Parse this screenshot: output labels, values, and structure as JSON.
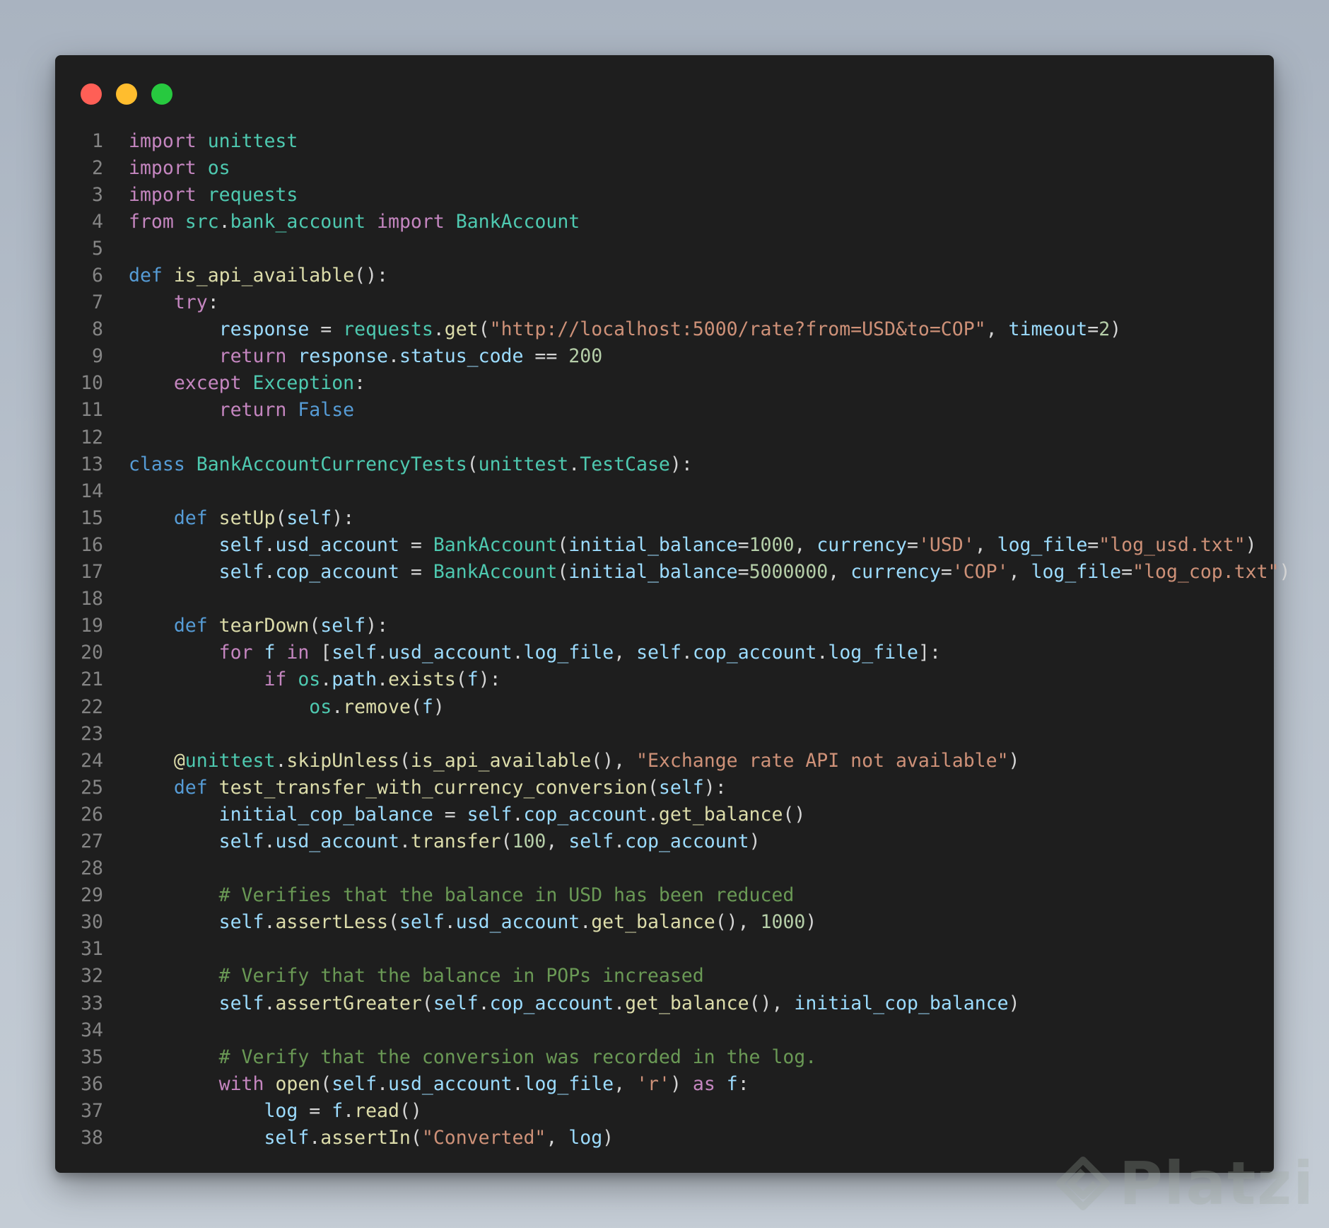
{
  "window": {
    "buttons": [
      {
        "name": "close",
        "color": "#ff5f56"
      },
      {
        "name": "minimize",
        "color": "#ffbd2e"
      },
      {
        "name": "maximize",
        "color": "#27c93f"
      }
    ]
  },
  "colors": {
    "keyword": "#c586c0",
    "definition": "#569cd6",
    "type": "#4ec9b0",
    "function": "#dcdcaa",
    "variable": "#9cdcfe",
    "string": "#ce9178",
    "number": "#b5cea8",
    "comment": "#6a9955",
    "plain": "#d4d4d4"
  },
  "code": {
    "language": "python",
    "lines": [
      [
        [
          "kw",
          "import"
        ],
        [
          "p",
          " "
        ],
        [
          "mod",
          "unittest"
        ]
      ],
      [
        [
          "kw",
          "import"
        ],
        [
          "p",
          " "
        ],
        [
          "mod",
          "os"
        ]
      ],
      [
        [
          "kw",
          "import"
        ],
        [
          "p",
          " "
        ],
        [
          "mod",
          "requests"
        ]
      ],
      [
        [
          "kw",
          "from"
        ],
        [
          "p",
          " "
        ],
        [
          "mod",
          "src"
        ],
        [
          "p",
          "."
        ],
        [
          "mod",
          "bank_account"
        ],
        [
          "p",
          " "
        ],
        [
          "kw",
          "import"
        ],
        [
          "p",
          " "
        ],
        [
          "mod",
          "BankAccount"
        ]
      ],
      [],
      [
        [
          "def",
          "def"
        ],
        [
          "p",
          " "
        ],
        [
          "fn",
          "is_api_available"
        ],
        [
          "p",
          "():"
        ]
      ],
      [
        [
          "p",
          "    "
        ],
        [
          "kw",
          "try"
        ],
        [
          "p",
          ":"
        ]
      ],
      [
        [
          "p",
          "        "
        ],
        [
          "var",
          "response"
        ],
        [
          "p",
          " = "
        ],
        [
          "mod",
          "requests"
        ],
        [
          "p",
          "."
        ],
        [
          "fn",
          "get"
        ],
        [
          "p",
          "("
        ],
        [
          "str",
          "\"http://localhost:5000/rate?from=USD&to=COP\""
        ],
        [
          "p",
          ", "
        ],
        [
          "var",
          "timeout"
        ],
        [
          "p",
          "="
        ],
        [
          "num",
          "2"
        ],
        [
          "p",
          ")"
        ]
      ],
      [
        [
          "p",
          "        "
        ],
        [
          "kw",
          "return"
        ],
        [
          "p",
          " "
        ],
        [
          "var",
          "response"
        ],
        [
          "p",
          "."
        ],
        [
          "var",
          "status_code"
        ],
        [
          "p",
          " == "
        ],
        [
          "num",
          "200"
        ]
      ],
      [
        [
          "p",
          "    "
        ],
        [
          "kw",
          "except"
        ],
        [
          "p",
          " "
        ],
        [
          "mod",
          "Exception"
        ],
        [
          "p",
          ":"
        ]
      ],
      [
        [
          "p",
          "        "
        ],
        [
          "kw",
          "return"
        ],
        [
          "p",
          " "
        ],
        [
          "def",
          "False"
        ]
      ],
      [],
      [
        [
          "def",
          "class"
        ],
        [
          "p",
          " "
        ],
        [
          "mod",
          "BankAccountCurrencyTests"
        ],
        [
          "p",
          "("
        ],
        [
          "mod",
          "unittest"
        ],
        [
          "p",
          "."
        ],
        [
          "mod",
          "TestCase"
        ],
        [
          "p",
          "):"
        ]
      ],
      [],
      [
        [
          "p",
          "    "
        ],
        [
          "def",
          "def"
        ],
        [
          "p",
          " "
        ],
        [
          "fn",
          "setUp"
        ],
        [
          "p",
          "("
        ],
        [
          "var",
          "self"
        ],
        [
          "p",
          "):"
        ]
      ],
      [
        [
          "p",
          "        "
        ],
        [
          "var",
          "self"
        ],
        [
          "p",
          "."
        ],
        [
          "var",
          "usd_account"
        ],
        [
          "p",
          " = "
        ],
        [
          "mod",
          "BankAccount"
        ],
        [
          "p",
          "("
        ],
        [
          "var",
          "initial_balance"
        ],
        [
          "p",
          "="
        ],
        [
          "num",
          "1000"
        ],
        [
          "p",
          ", "
        ],
        [
          "var",
          "currency"
        ],
        [
          "p",
          "="
        ],
        [
          "str",
          "'USD'"
        ],
        [
          "p",
          ", "
        ],
        [
          "var",
          "log_file"
        ],
        [
          "p",
          "="
        ],
        [
          "str",
          "\"log_usd.txt\""
        ],
        [
          "p",
          ")"
        ]
      ],
      [
        [
          "p",
          "        "
        ],
        [
          "var",
          "self"
        ],
        [
          "p",
          "."
        ],
        [
          "var",
          "cop_account"
        ],
        [
          "p",
          " = "
        ],
        [
          "mod",
          "BankAccount"
        ],
        [
          "p",
          "("
        ],
        [
          "var",
          "initial_balance"
        ],
        [
          "p",
          "="
        ],
        [
          "num",
          "5000000"
        ],
        [
          "p",
          ", "
        ],
        [
          "var",
          "currency"
        ],
        [
          "p",
          "="
        ],
        [
          "str",
          "'COP'"
        ],
        [
          "p",
          ", "
        ],
        [
          "var",
          "log_file"
        ],
        [
          "p",
          "="
        ],
        [
          "str",
          "\"log_cop.txt\""
        ],
        [
          "p",
          ")"
        ]
      ],
      [],
      [
        [
          "p",
          "    "
        ],
        [
          "def",
          "def"
        ],
        [
          "p",
          " "
        ],
        [
          "fn",
          "tearDown"
        ],
        [
          "p",
          "("
        ],
        [
          "var",
          "self"
        ],
        [
          "p",
          "):"
        ]
      ],
      [
        [
          "p",
          "        "
        ],
        [
          "kw",
          "for"
        ],
        [
          "p",
          " "
        ],
        [
          "var",
          "f"
        ],
        [
          "p",
          " "
        ],
        [
          "kw",
          "in"
        ],
        [
          "p",
          " ["
        ],
        [
          "var",
          "self"
        ],
        [
          "p",
          "."
        ],
        [
          "var",
          "usd_account"
        ],
        [
          "p",
          "."
        ],
        [
          "var",
          "log_file"
        ],
        [
          "p",
          ", "
        ],
        [
          "var",
          "self"
        ],
        [
          "p",
          "."
        ],
        [
          "var",
          "cop_account"
        ],
        [
          "p",
          "."
        ],
        [
          "var",
          "log_file"
        ],
        [
          "p",
          "]:"
        ]
      ],
      [
        [
          "p",
          "            "
        ],
        [
          "kw",
          "if"
        ],
        [
          "p",
          " "
        ],
        [
          "mod",
          "os"
        ],
        [
          "p",
          "."
        ],
        [
          "var",
          "path"
        ],
        [
          "p",
          "."
        ],
        [
          "fn",
          "exists"
        ],
        [
          "p",
          "("
        ],
        [
          "var",
          "f"
        ],
        [
          "p",
          "):"
        ]
      ],
      [
        [
          "p",
          "                "
        ],
        [
          "mod",
          "os"
        ],
        [
          "p",
          "."
        ],
        [
          "fn",
          "remove"
        ],
        [
          "p",
          "("
        ],
        [
          "var",
          "f"
        ],
        [
          "p",
          ")"
        ]
      ],
      [],
      [
        [
          "p",
          "    "
        ],
        [
          "fn",
          "@"
        ],
        [
          "mod",
          "unittest"
        ],
        [
          "p",
          "."
        ],
        [
          "fn",
          "skipUnless"
        ],
        [
          "p",
          "("
        ],
        [
          "fn",
          "is_api_available"
        ],
        [
          "p",
          "(), "
        ],
        [
          "str",
          "\"Exchange rate API not available\""
        ],
        [
          "p",
          ")"
        ]
      ],
      [
        [
          "p",
          "    "
        ],
        [
          "def",
          "def"
        ],
        [
          "p",
          " "
        ],
        [
          "fn",
          "test_transfer_with_currency_conversion"
        ],
        [
          "p",
          "("
        ],
        [
          "var",
          "self"
        ],
        [
          "p",
          "):"
        ]
      ],
      [
        [
          "p",
          "        "
        ],
        [
          "var",
          "initial_cop_balance"
        ],
        [
          "p",
          " = "
        ],
        [
          "var",
          "self"
        ],
        [
          "p",
          "."
        ],
        [
          "var",
          "cop_account"
        ],
        [
          "p",
          "."
        ],
        [
          "fn",
          "get_balance"
        ],
        [
          "p",
          "()"
        ]
      ],
      [
        [
          "p",
          "        "
        ],
        [
          "var",
          "self"
        ],
        [
          "p",
          "."
        ],
        [
          "var",
          "usd_account"
        ],
        [
          "p",
          "."
        ],
        [
          "fn",
          "transfer"
        ],
        [
          "p",
          "("
        ],
        [
          "num",
          "100"
        ],
        [
          "p",
          ", "
        ],
        [
          "var",
          "self"
        ],
        [
          "p",
          "."
        ],
        [
          "var",
          "cop_account"
        ],
        [
          "p",
          ")"
        ]
      ],
      [],
      [
        [
          "p",
          "        "
        ],
        [
          "com",
          "# Verifies that the balance in USD has been reduced"
        ]
      ],
      [
        [
          "p",
          "        "
        ],
        [
          "var",
          "self"
        ],
        [
          "p",
          "."
        ],
        [
          "fn",
          "assertLess"
        ],
        [
          "p",
          "("
        ],
        [
          "var",
          "self"
        ],
        [
          "p",
          "."
        ],
        [
          "var",
          "usd_account"
        ],
        [
          "p",
          "."
        ],
        [
          "fn",
          "get_balance"
        ],
        [
          "p",
          "(), "
        ],
        [
          "num",
          "1000"
        ],
        [
          "p",
          ")"
        ]
      ],
      [],
      [
        [
          "p",
          "        "
        ],
        [
          "com",
          "# Verify that the balance in POPs increased"
        ]
      ],
      [
        [
          "p",
          "        "
        ],
        [
          "var",
          "self"
        ],
        [
          "p",
          "."
        ],
        [
          "fn",
          "assertGreater"
        ],
        [
          "p",
          "("
        ],
        [
          "var",
          "self"
        ],
        [
          "p",
          "."
        ],
        [
          "var",
          "cop_account"
        ],
        [
          "p",
          "."
        ],
        [
          "fn",
          "get_balance"
        ],
        [
          "p",
          "(), "
        ],
        [
          "var",
          "initial_cop_balance"
        ],
        [
          "p",
          ")"
        ]
      ],
      [],
      [
        [
          "p",
          "        "
        ],
        [
          "com",
          "# Verify that the conversion was recorded in the log."
        ]
      ],
      [
        [
          "p",
          "        "
        ],
        [
          "kw",
          "with"
        ],
        [
          "p",
          " "
        ],
        [
          "fn",
          "open"
        ],
        [
          "p",
          "("
        ],
        [
          "var",
          "self"
        ],
        [
          "p",
          "."
        ],
        [
          "var",
          "usd_account"
        ],
        [
          "p",
          "."
        ],
        [
          "var",
          "log_file"
        ],
        [
          "p",
          ", "
        ],
        [
          "str",
          "'r'"
        ],
        [
          "p",
          ") "
        ],
        [
          "kw",
          "as"
        ],
        [
          "p",
          " "
        ],
        [
          "var",
          "f"
        ],
        [
          "p",
          ":"
        ]
      ],
      [
        [
          "p",
          "            "
        ],
        [
          "var",
          "log"
        ],
        [
          "p",
          " = "
        ],
        [
          "var",
          "f"
        ],
        [
          "p",
          "."
        ],
        [
          "fn",
          "read"
        ],
        [
          "p",
          "()"
        ]
      ],
      [
        [
          "p",
          "            "
        ],
        [
          "var",
          "self"
        ],
        [
          "p",
          "."
        ],
        [
          "fn",
          "assertIn"
        ],
        [
          "p",
          "("
        ],
        [
          "str",
          "\"Converted\""
        ],
        [
          "p",
          ", "
        ],
        [
          "var",
          "log"
        ],
        [
          "p",
          ")"
        ]
      ]
    ]
  },
  "watermark": {
    "text": "Platzi",
    "icon": "platzi-logo-icon"
  }
}
